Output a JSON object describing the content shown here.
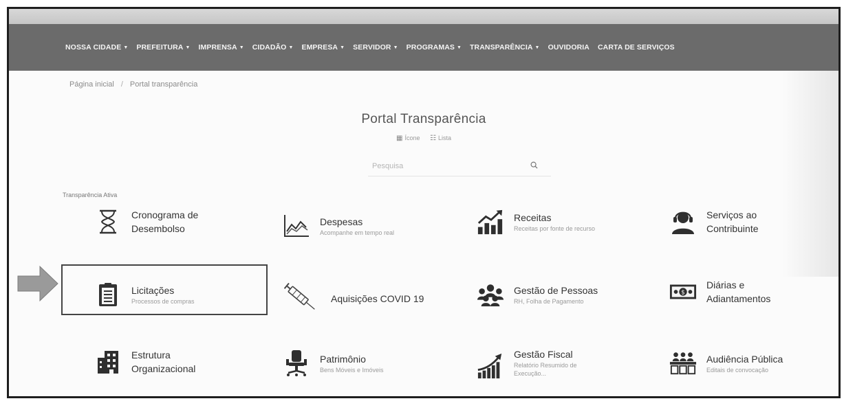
{
  "nav": {
    "items": [
      {
        "label": "NOSSA CIDADE",
        "has_caret": true
      },
      {
        "label": "PREFEITURA",
        "has_caret": true
      },
      {
        "label": "IMPRENSA",
        "has_caret": true
      },
      {
        "label": "CIDADÃO",
        "has_caret": true
      },
      {
        "label": "EMPRESA",
        "has_caret": true
      },
      {
        "label": "SERVIDOR",
        "has_caret": true
      },
      {
        "label": "PROGRAMAS",
        "has_caret": true
      },
      {
        "label": "TRANSPARÊNCIA",
        "has_caret": true
      },
      {
        "label": "OUVIDORIA",
        "has_caret": false
      },
      {
        "label": "CARTA DE SERVIÇOS",
        "has_caret": false
      }
    ],
    "caret": "▼"
  },
  "breadcrumb": {
    "home": "Página inicial",
    "separator": "/",
    "current": "Portal transparência"
  },
  "page": {
    "title": "Portal Transparência"
  },
  "view_toggle": {
    "icon_label": "Ícone",
    "list_label": "Lista"
  },
  "search": {
    "placeholder": "Pesquisa",
    "icon": "search-icon"
  },
  "section": {
    "label": "Transparência Ativa"
  },
  "cards": [
    {
      "title": "Cronograma de",
      "title2": "Desembolso",
      "subtitle": "",
      "icon": "hourglass-icon"
    },
    {
      "title": "Despesas",
      "title2": "",
      "subtitle": "Acompanhe em tempo real",
      "icon": "chart-line-icon"
    },
    {
      "title": "Receitas",
      "title2": "",
      "subtitle": "Receitas por fonte de recurso",
      "icon": "rising-bars-icon"
    },
    {
      "title": "Serviços ao",
      "title2": "Contribuinte",
      "subtitle": "",
      "icon": "headset-agent-icon"
    },
    {
      "title": "Licitações",
      "title2": "",
      "subtitle": "Processos de compras",
      "icon": "clipboard-icon"
    },
    {
      "title": "Aquisições COVID 19",
      "title2": "",
      "subtitle": "",
      "icon": "syringe-icon"
    },
    {
      "title": "Gestão de Pessoas",
      "title2": "",
      "subtitle": "RH, Folha de Pagamento",
      "icon": "people-group-icon"
    },
    {
      "title": "Diárias e",
      "title2": "Adiantamentos",
      "subtitle": "",
      "icon": "money-bill-icon"
    },
    {
      "title": "Estrutura",
      "title2": "Organizacional",
      "subtitle": "",
      "icon": "building-icon"
    },
    {
      "title": "Patrimônio",
      "title2": "",
      "subtitle": "Bens Móveis e Imóveis",
      "icon": "office-chair-icon"
    },
    {
      "title": "Gestão Fiscal",
      "title2": "",
      "subtitle": "Relatório Resumido de",
      "subtitle2": "Execução...",
      "icon": "growth-chart-icon"
    },
    {
      "title": "Audiência Pública",
      "title2": "",
      "subtitle": "Editais de convocação",
      "icon": "audience-icon"
    }
  ],
  "colors": {
    "navbar": "#6b6b6b",
    "text": "#333333",
    "muted": "#9a9a9a",
    "icon": "#3a3a3a"
  }
}
